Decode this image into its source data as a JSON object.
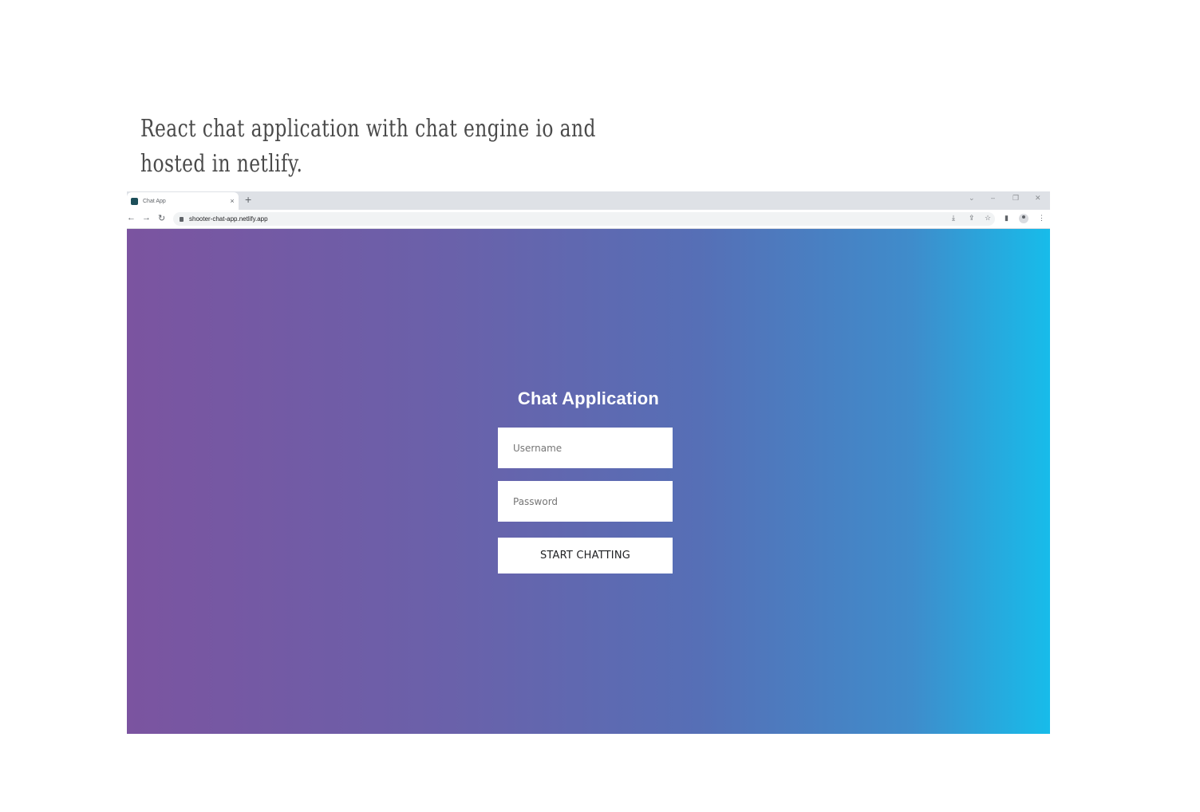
{
  "caption": {
    "line1": "React chat application with chat engine io and",
    "line2": "hosted in netlify."
  },
  "browser": {
    "tab_title": "Chat App",
    "tab_close": "×",
    "new_tab": "+",
    "window_controls": {
      "collapse": "⌄",
      "minimize": "–",
      "restore": "❐",
      "close": "✕"
    },
    "nav": {
      "back": "←",
      "forward": "→",
      "reload": "↻"
    },
    "url": "shooter-chat-app.netlify.app",
    "toolbar_icons": {
      "install": "⤓",
      "share": "⇪",
      "bookmark": "☆",
      "side_panel": "▮",
      "menu": "⋮"
    }
  },
  "app": {
    "title": "Chat Application",
    "username_placeholder": "Username",
    "password_placeholder": "Password",
    "submit_label": "START CHATTING",
    "gradient_colors": [
      "#7b54a0",
      "#566fb6",
      "#17bcea"
    ]
  }
}
